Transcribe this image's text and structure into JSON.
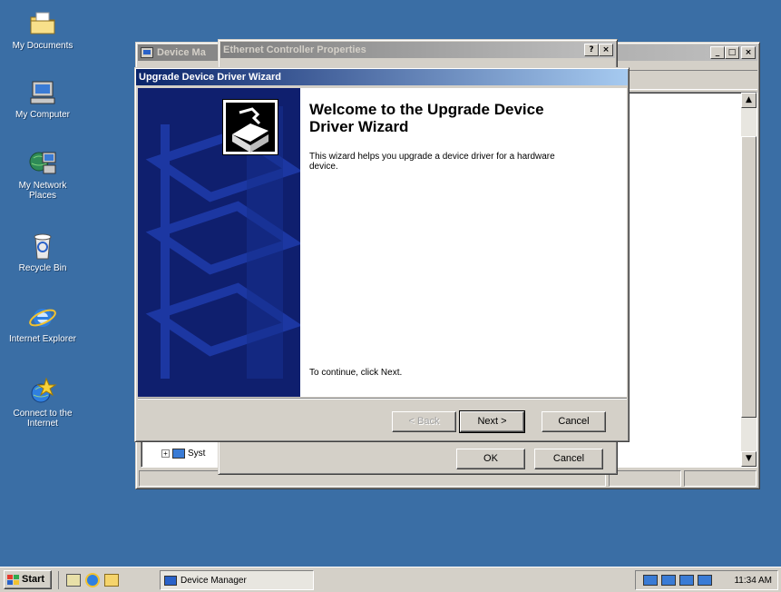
{
  "desktop": {
    "icons": [
      {
        "label": "My Documents",
        "icon": "folder-documents-icon"
      },
      {
        "label": "My Computer",
        "icon": "computer-icon"
      },
      {
        "label": "My Network Places",
        "icon": "network-places-icon"
      },
      {
        "label": "Recycle Bin",
        "icon": "recycle-bin-icon"
      },
      {
        "label": "Internet Explorer",
        "icon": "internet-explorer-icon"
      },
      {
        "label": "Connect to the Internet",
        "icon": "connect-internet-icon"
      }
    ]
  },
  "device_manager": {
    "title": "Device Ma",
    "tree_item": "Syst",
    "controls": {
      "minimize": "_",
      "maximize": "□",
      "close": "×"
    }
  },
  "ethernet_props": {
    "title": "Ethernet Controller Properties",
    "controls": {
      "help": "?",
      "close": "×"
    },
    "ok_label": "OK",
    "cancel_label": "Cancel"
  },
  "wizard": {
    "title": "Upgrade Device Driver Wizard",
    "heading": "Welcome to the Upgrade Device Driver Wizard",
    "body": "This wizard helps you upgrade a device driver for a hardware device.",
    "continue_text": "To continue, click Next.",
    "back_label": "< Back",
    "next_label": "Next >",
    "cancel_label": "Cancel"
  },
  "taskbar": {
    "start_label": "Start",
    "task_label": "Device Manager",
    "clock": "11:34 AM"
  },
  "colors": {
    "desktop": "#3a6ea5",
    "title_active": "#0a246a",
    "wizard_side": "#0f1f6e"
  }
}
